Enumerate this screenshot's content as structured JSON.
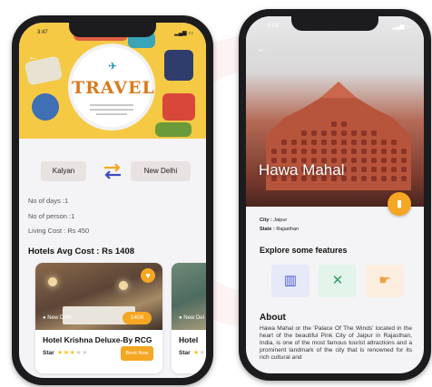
{
  "phone1": {
    "status_time": "3:47",
    "hero": {
      "title": "TRAVEL"
    },
    "route": {
      "from": "Kalyan",
      "to": "New Delhi"
    },
    "info": {
      "days": "No of days :1",
      "persons": "No of person :1",
      "living_cost": "Living Cost : Rs 450"
    },
    "hotels_heading": "Hotels Avg Cost : Rs 1408",
    "hotels": [
      {
        "location": "New Delhi",
        "price": "1400",
        "name": "Hotel Krishna Deluxe-By RCG",
        "star_label": "Star",
        "rating": 3,
        "max_rating": 5,
        "book_label": "Book Now"
      },
      {
        "location": "New Del",
        "price": "",
        "name": "Hotel",
        "star_label": "Star",
        "rating": 1,
        "max_rating": 5,
        "book_label": ""
      }
    ],
    "colors": {
      "accent": "#f5a623",
      "hero_bg": "#f6c945",
      "swap_orange": "#f5a623",
      "swap_blue": "#3b4cc0"
    }
  },
  "phone2": {
    "status_time": "4:05",
    "place_name": "Hawa Mahal",
    "city": {
      "label": "City :",
      "value": "Jaipur"
    },
    "state": {
      "label": "State :",
      "value": "Rajasthan"
    },
    "explore_heading": "Explore some features",
    "features": [
      {
        "icon": "building-icon",
        "bg": "#e6e9f8",
        "fg": "#4a5bd0"
      },
      {
        "icon": "tools-icon",
        "bg": "#e3f4ea",
        "fg": "#2f9e63"
      },
      {
        "icon": "hand-icon",
        "bg": "#fbeede",
        "fg": "#f0a040"
      }
    ],
    "about_heading": "About",
    "about_text": "Hawa Mahal or the 'Palace Of The Winds' located in the heart of the beautiful Pink City of Jaipur in Rajasthan, India, is one of the most famous tourist attractions and a prominent landmark of the city that is renowned for its rich cultural and",
    "colors": {
      "accent": "#f5a623"
    }
  }
}
